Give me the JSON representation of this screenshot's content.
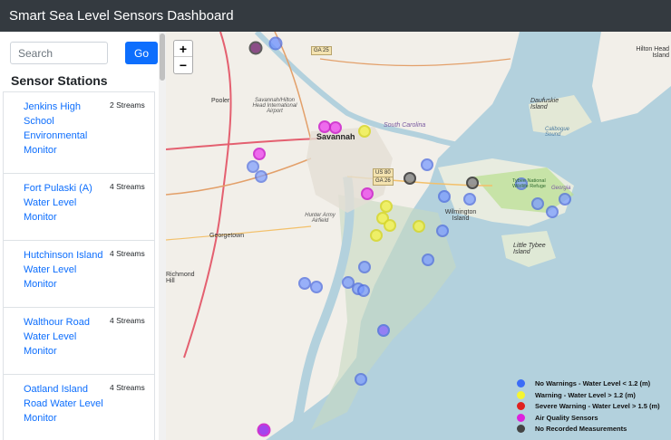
{
  "header": {
    "title": "Smart Sea Level Sensors Dashboard"
  },
  "search": {
    "placeholder": "Search",
    "go_label": "Go"
  },
  "sidebar": {
    "heading": "Sensor Stations",
    "stations": [
      {
        "name": "Jenkins High School Environmental Monitor",
        "streams": "2 Streams"
      },
      {
        "name": "Fort Pulaski (A) Water Level Monitor",
        "streams": "4 Streams"
      },
      {
        "name": "Hutchinson Island Water Level Monitor",
        "streams": "4 Streams"
      },
      {
        "name": "Walthour Road Water Level Monitor",
        "streams": "4 Streams"
      },
      {
        "name": "Oatland Island Road Water Level Monitor",
        "streams": "4 Streams"
      }
    ]
  },
  "map": {
    "zoom_in": "+",
    "zoom_out": "−",
    "labels": {
      "savannah": "Savannah",
      "pooler": "Pooler",
      "georgetown": "Georgetown",
      "wilmington": "Wilmington Island",
      "hilton_head": "Hilton Head Island",
      "daufuskie": "Daufuskie Island",
      "little_tybee": "Little Tybee Island",
      "airport": "Savannah/Hilton Head International Airport",
      "hunter": "Hunter Army Airfield",
      "richmond": "Richmond Hill",
      "south_carolina": "South Carolina",
      "calibogue": "Calibogue Sound",
      "tybee": "Tybee National Wildlife Refuge",
      "georgia": "Georgia",
      "ga25": "GA 25",
      "us80": "US 80",
      "ga26": "GA 26"
    },
    "colors": {
      "water": "#b3d1dd",
      "land": "#f2efe9",
      "marsh": "#dfe9d6",
      "blue": "#4f7bff",
      "yellow": "#f0f030",
      "red": "#e02020",
      "magenta": "#dd22dd",
      "gray": "#555555"
    }
  },
  "legend": [
    {
      "label": "No Warnings - Water Level < 1.2 (m)",
      "color": "#3b6cf7"
    },
    {
      "label": "Warning - Water Level > 1.2 (m)",
      "color": "#f5f531"
    },
    {
      "label": "Severe Warning - Water Level > 1.5 (m)",
      "color": "#e02020"
    },
    {
      "label": "Air Quality Sensors",
      "color": "#dd22dd"
    },
    {
      "label": "No Recorded Measurements",
      "color": "#444444"
    }
  ]
}
